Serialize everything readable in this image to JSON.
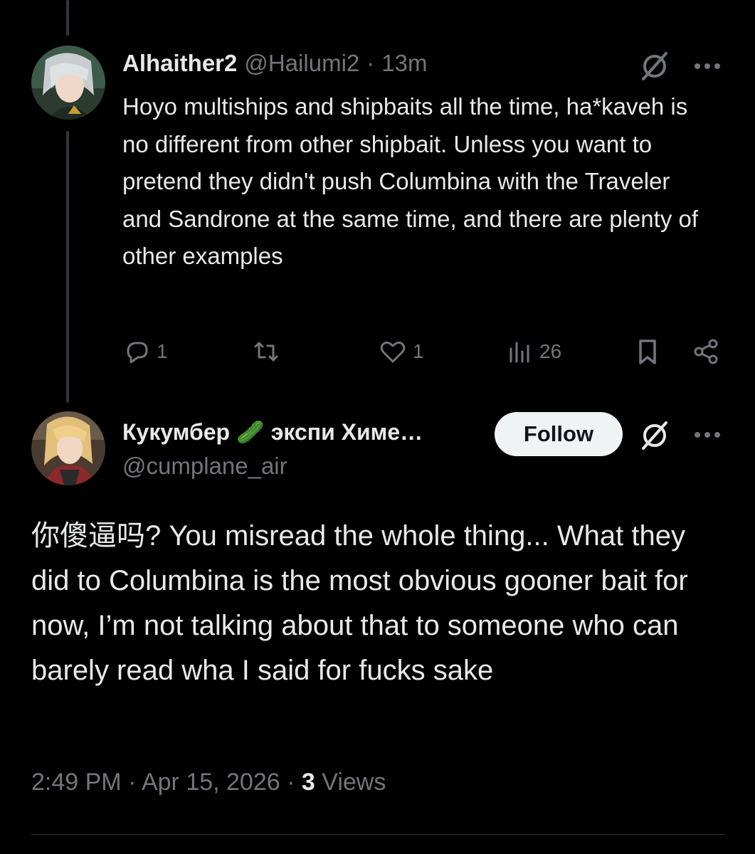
{
  "tweet1": {
    "display_name": "Alhaither2",
    "handle": "@Hailumi2",
    "separator": "·",
    "time": "13m",
    "icons": {
      "grok": "grok-icon",
      "more": "more-icon"
    },
    "body": "Hoyo multiships and shipbaits all the time, ha*kaveh is no different from other shipbait. Unless you want to pretend they didn't push Columbina with the Traveler and Sandrone at the same time, and there are plenty of other examples",
    "actions": {
      "reply_count": "1",
      "repost_count": "",
      "like_count": "1",
      "views_count": "26"
    }
  },
  "tweet2": {
    "display_name": "Кукумбер 🥒 экспи Химе…",
    "handle": "@cumplane_air",
    "follow_label": "Follow",
    "body": "你傻逼吗? You misread the whole thing... What they did to Columbina is the most obvious gooner bait for now, I’m not talking about that to someone who can barely read wha I said for fucks sake",
    "timestamp": "2:49 PM · Apr 15, 2026 · ",
    "views_count": "3",
    "views_label": " Views"
  },
  "colors": {
    "background": "#000000",
    "text": "#e7e9ea",
    "muted": "#71767b",
    "button_bg": "#eff3f4",
    "button_text": "#0f1419",
    "divider": "#2f3336"
  }
}
